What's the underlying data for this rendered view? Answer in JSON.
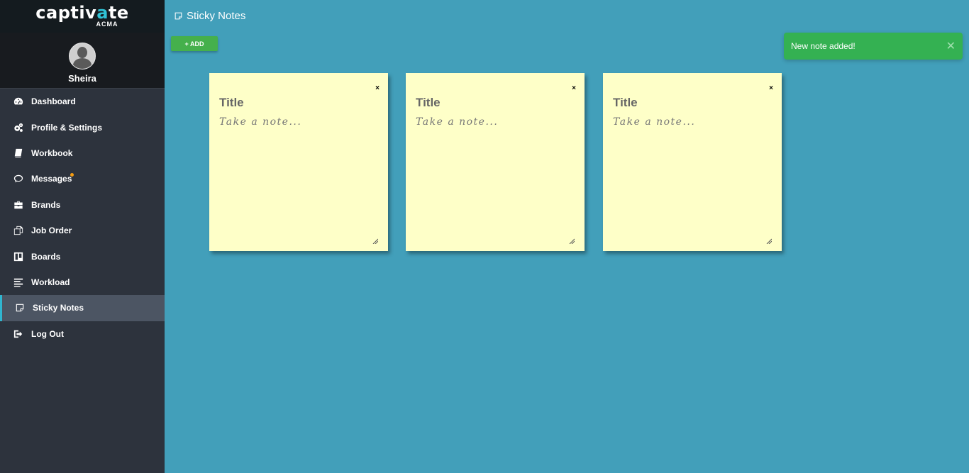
{
  "brand": {
    "name_part1": "c",
    "name_accent": "∧",
    "name_part2": "ptiv",
    "name_accent2": "∧",
    "name_part3": "te",
    "subtitle": "ACMA"
  },
  "user": {
    "name": "Sheira"
  },
  "nav": {
    "items": [
      {
        "label": "Dashboard",
        "icon": "dashboard-icon"
      },
      {
        "label": "Profile & Settings",
        "icon": "gears-icon"
      },
      {
        "label": "Workbook",
        "icon": "book-icon"
      },
      {
        "label": "Messages",
        "icon": "chat-icon",
        "badge": true
      },
      {
        "label": "Brands",
        "icon": "briefcase-icon"
      },
      {
        "label": "Job Order",
        "icon": "copy-icon"
      },
      {
        "label": "Boards",
        "icon": "board-icon"
      },
      {
        "label": "Workload",
        "icon": "align-left-icon"
      },
      {
        "label": "Sticky Notes",
        "icon": "sticky-note-icon",
        "active": true
      },
      {
        "label": "Log Out",
        "icon": "sign-out-icon"
      }
    ]
  },
  "page": {
    "title": "Sticky Notes"
  },
  "toolbar": {
    "add_label": "+ ADD"
  },
  "toast": {
    "message": "New note added!",
    "close": "✕",
    "color": "#34b152"
  },
  "notes": [
    {
      "title": "Title",
      "placeholder": "Take a note...",
      "close": "×"
    },
    {
      "title": "Title",
      "placeholder": "Take a note...",
      "close": "×"
    },
    {
      "title": "Title",
      "placeholder": "Take a note...",
      "close": "×"
    }
  ],
  "colors": {
    "background": "#429fba",
    "sidebar": "#2d333d",
    "note": "#feffc8",
    "active_accent": "#30b6d0"
  }
}
